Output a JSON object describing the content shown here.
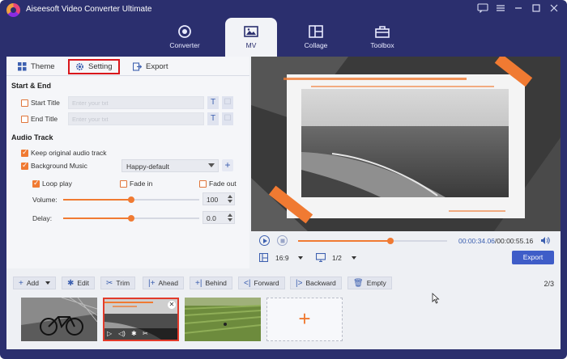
{
  "app": {
    "title": "Aiseesoft Video Converter Ultimate",
    "accent": "#f07a32",
    "brand": "#2b2f6e"
  },
  "window_controls": [
    "chat-icon",
    "menu-icon",
    "minimize-icon",
    "maximize-icon",
    "close-icon"
  ],
  "main_tabs": [
    {
      "label": "Converter",
      "icon": "converter-icon",
      "active": false
    },
    {
      "label": "MV",
      "icon": "mv-icon",
      "active": true
    },
    {
      "label": "Collage",
      "icon": "collage-icon",
      "active": false
    },
    {
      "label": "Toolbox",
      "icon": "toolbox-icon",
      "active": false
    }
  ],
  "sub_tabs": [
    {
      "label": "Theme",
      "icon": "theme-icon"
    },
    {
      "label": "Setting",
      "icon": "gear-icon",
      "active": true
    },
    {
      "label": "Export",
      "icon": "export-icon"
    }
  ],
  "settings": {
    "start_end_title": "Start & End",
    "start_title": {
      "label": "Start Title",
      "checked": false,
      "placeholder": "Enter your txt"
    },
    "end_title": {
      "label": "End Title",
      "checked": false,
      "placeholder": "Enter your txt"
    },
    "audio_track_title": "Audio Track",
    "keep_original": {
      "label": "Keep original audio track",
      "checked": true
    },
    "background_music": {
      "label": "Background Music",
      "checked": true,
      "value": "Happy-default"
    },
    "loop_play": {
      "label": "Loop play",
      "checked": true
    },
    "fade_in": {
      "label": "Fade in",
      "checked": false
    },
    "fade_out": {
      "label": "Fade out",
      "checked": false
    },
    "volume": {
      "label": "Volume:",
      "value": "100",
      "level": 0.5
    },
    "delay": {
      "label": "Delay:",
      "value": "0.0",
      "level": 0.5
    }
  },
  "player": {
    "time_current": "00:00:34.06",
    "time_total": "/00:00:55.16",
    "progress": 0.62,
    "aspect": "16:9",
    "page": "1/2",
    "export_label": "Export"
  },
  "toolbar": {
    "add": "Add",
    "edit": "Edit",
    "trim": "Trim",
    "ahead": "Ahead",
    "behind": "Behind",
    "forward": "Forward",
    "backward": "Backward",
    "empty": "Empty",
    "page_count": "2/3"
  },
  "timeline": {
    "clips": [
      "bicycle-clip",
      "beach-clip",
      "field-clip"
    ],
    "selected_index": 1
  }
}
